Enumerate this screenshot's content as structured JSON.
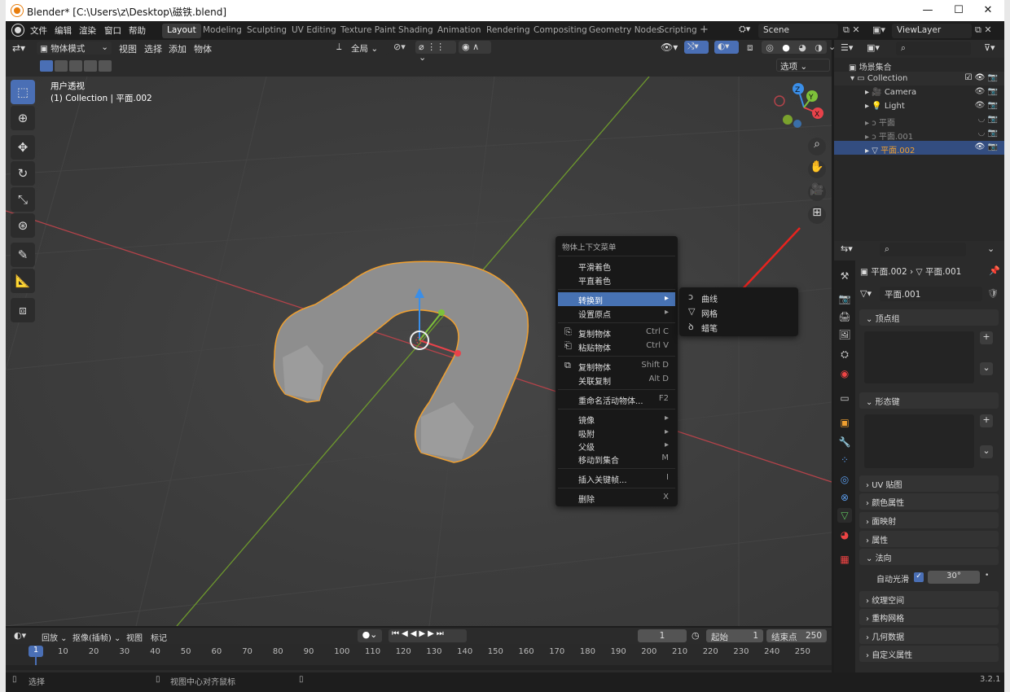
{
  "window": {
    "title": "Blender* [C:\\Users\\z\\Desktop\\磁铁.blend]",
    "minimize": "—",
    "maximize": "☐",
    "close": "✕"
  },
  "menubar": {
    "items": [
      "文件",
      "编辑",
      "渲染",
      "窗口",
      "帮助"
    ]
  },
  "workspaces": [
    "Layout",
    "Modeling",
    "Sculpting",
    "UV Editing",
    "Texture Paint",
    "Shading",
    "Animation",
    "Rendering",
    "Compositing",
    "Geometry Nodes",
    "Scripting",
    "+"
  ],
  "scene": {
    "name": "Scene",
    "view_layer": "ViewLayer"
  },
  "viewport_header": {
    "mode": "物体模式",
    "menus": [
      "视图",
      "选择",
      "添加",
      "物体"
    ],
    "transform": "全局",
    "options": "选项"
  },
  "viewport": {
    "view_name": "用户透视",
    "collection_info": "(1) Collection | 平面.002"
  },
  "context_menu": {
    "title": "物体上下文菜单",
    "items": [
      {
        "label": "平滑着色",
        "shortcut": "",
        "icon": ""
      },
      {
        "label": "平直着色",
        "shortcut": "",
        "icon": ""
      },
      {
        "label": "转换到",
        "shortcut": "▸",
        "icon": ""
      },
      {
        "label": "设置原点",
        "shortcut": "▸",
        "icon": ""
      },
      {
        "label": "复制物体",
        "shortcut": "Ctrl C",
        "icon": "copy-icon"
      },
      {
        "label": "粘贴物体",
        "shortcut": "Ctrl V",
        "icon": "paste-icon"
      },
      {
        "label": "复制物体",
        "shortcut": "Shift D",
        "icon": "duplicate-icon"
      },
      {
        "label": "关联复制",
        "shortcut": "Alt D",
        "icon": ""
      },
      {
        "label": "重命名活动物体...",
        "shortcut": "F2",
        "icon": ""
      },
      {
        "label": "镜像",
        "shortcut": "▸",
        "icon": ""
      },
      {
        "label": "吸附",
        "shortcut": "▸",
        "icon": ""
      },
      {
        "label": "父级",
        "shortcut": "▸",
        "icon": ""
      },
      {
        "label": "移动到集合",
        "shortcut": "M",
        "icon": ""
      },
      {
        "label": "插入关键帧...",
        "shortcut": "I",
        "icon": ""
      },
      {
        "label": "删除",
        "shortcut": "X",
        "icon": ""
      }
    ]
  },
  "submenu": {
    "items": [
      {
        "label": "曲线",
        "icon": "curve-icon"
      },
      {
        "label": "网格",
        "icon": "mesh-icon"
      },
      {
        "label": "蜡笔",
        "icon": "grease-pencil-icon"
      }
    ]
  },
  "outliner": {
    "root": "场景集合",
    "collection": "Collection",
    "items": [
      {
        "name": "Camera",
        "active": false,
        "dim": false
      },
      {
        "name": "Light",
        "active": false,
        "dim": false
      },
      {
        "name": "平面",
        "active": false,
        "dim": true
      },
      {
        "name": "平面.001",
        "active": false,
        "dim": true
      },
      {
        "name": "平面.002",
        "active": true,
        "dim": false
      }
    ]
  },
  "properties": {
    "breadcrumb_obj": "平面.002",
    "breadcrumb_data": "平面.001",
    "mesh_name": "平面.001",
    "panels": [
      "顶点组",
      "形态键",
      "UV 贴图",
      "颜色属性",
      "面映射",
      "属性",
      "法向",
      "纹理空间",
      "重构网格",
      "几何数据",
      "自定义属性"
    ],
    "auto_smooth_label": "自动光滑",
    "auto_smooth_value": "30°"
  },
  "timeline": {
    "menus": [
      "回放",
      "抠像(插帧)",
      "视图",
      "标记"
    ],
    "current_frame": "1",
    "start_label": "起始",
    "start": "1",
    "end_label": "结束点",
    "end": "250",
    "ticks": [
      "10",
      "20",
      "30",
      "40",
      "50",
      "60",
      "70",
      "80",
      "90",
      "100",
      "110",
      "120",
      "130",
      "140",
      "150",
      "160",
      "170",
      "180",
      "190",
      "200",
      "210",
      "220",
      "230",
      "240",
      "250"
    ],
    "marker": "1"
  },
  "statusbar": {
    "left": "选择",
    "middle": "视图中心对齐鼠标",
    "version": "3.2.1"
  }
}
